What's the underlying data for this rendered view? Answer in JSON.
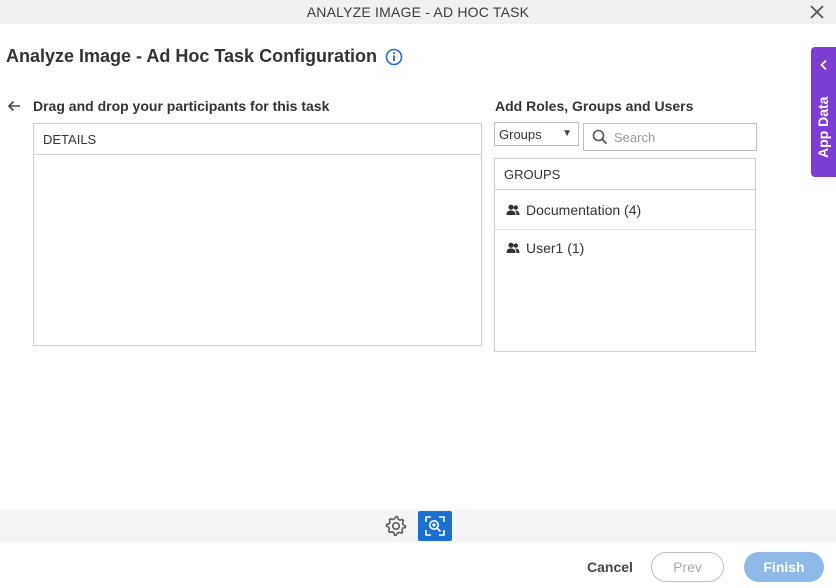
{
  "window": {
    "title": "ANALYZE IMAGE - AD HOC TASK"
  },
  "page": {
    "title": "Analyze Image - Ad Hoc Task Configuration"
  },
  "left": {
    "label": "Drag and drop your participants for this task",
    "panel_header": "DETAILS"
  },
  "right": {
    "label": "Add Roles, Groups and Users",
    "select_value": "Groups",
    "search_placeholder": "Search",
    "panel_header": "GROUPS",
    "items": [
      {
        "label": "Documentation (4)",
        "icon": "group-icon"
      },
      {
        "label": "User1 (1)",
        "icon": "group-icon"
      }
    ]
  },
  "side_tab": {
    "label": "App Data"
  },
  "footer": {
    "cancel_label": "Cancel",
    "prev_label": "Prev",
    "finish_label": "Finish"
  },
  "colors": {
    "accent_blue": "#1b6fd1",
    "app_data_purple": "#7d3cd4",
    "finish_disabled": "#8ebaea"
  }
}
